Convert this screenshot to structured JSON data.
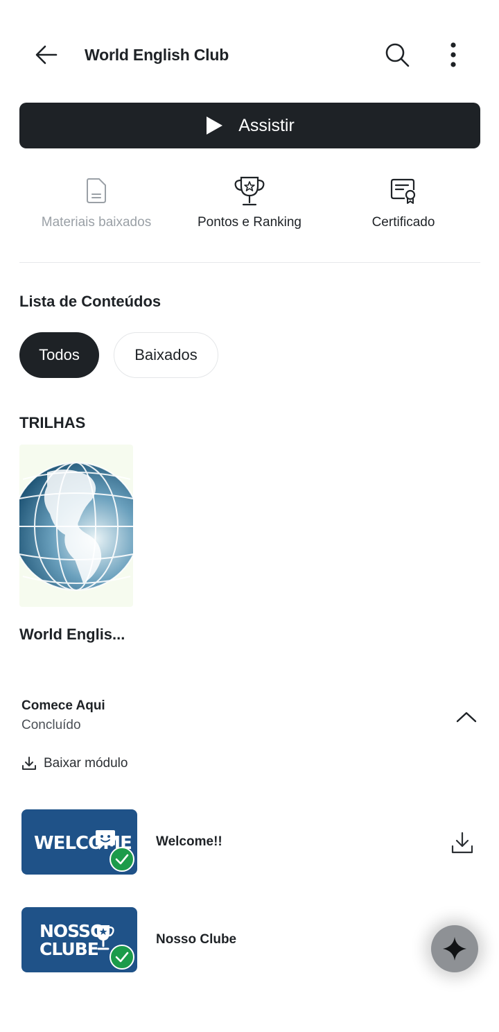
{
  "header": {
    "title": "World English Club",
    "back_icon": "arrow-left-icon",
    "search_icon": "search-icon",
    "more_icon": "more-vertical-icon"
  },
  "watch_button": {
    "label": "Assistir",
    "icon": "play-icon"
  },
  "actions": [
    {
      "label": "Materiais baixados",
      "icon": "document-icon",
      "enabled": false
    },
    {
      "label": "Pontos e Ranking",
      "icon": "trophy-icon",
      "enabled": true
    },
    {
      "label": "Certificado",
      "icon": "certificate-icon",
      "enabled": true
    }
  ],
  "content_list": {
    "title": "Lista de Conteúdos",
    "filters": [
      {
        "label": "Todos",
        "selected": true
      },
      {
        "label": "Baixados",
        "selected": false
      }
    ]
  },
  "trilhas": {
    "title": "TRILHAS",
    "items": [
      {
        "name": "World Englis...",
        "thumb_icon": "globe-image"
      }
    ]
  },
  "module": {
    "title": "Comece Aqui",
    "status": "Concluído",
    "download_label": "Baixar módulo",
    "lessons": [
      {
        "name": "Welcome!!",
        "thumb_text": "WELCOME",
        "completed": true
      },
      {
        "name": "Nosso Clube",
        "thumb_text_1": "NOSSO",
        "thumb_text_2": "CLUBE",
        "completed": true
      }
    ]
  },
  "colors": {
    "primary_dark": "#1e2226",
    "success_green": "#1c9b4a",
    "thumb_blue": "#1f5288",
    "muted_text": "#9aa0a6"
  },
  "fab": {
    "icon": "sparkle-icon"
  }
}
